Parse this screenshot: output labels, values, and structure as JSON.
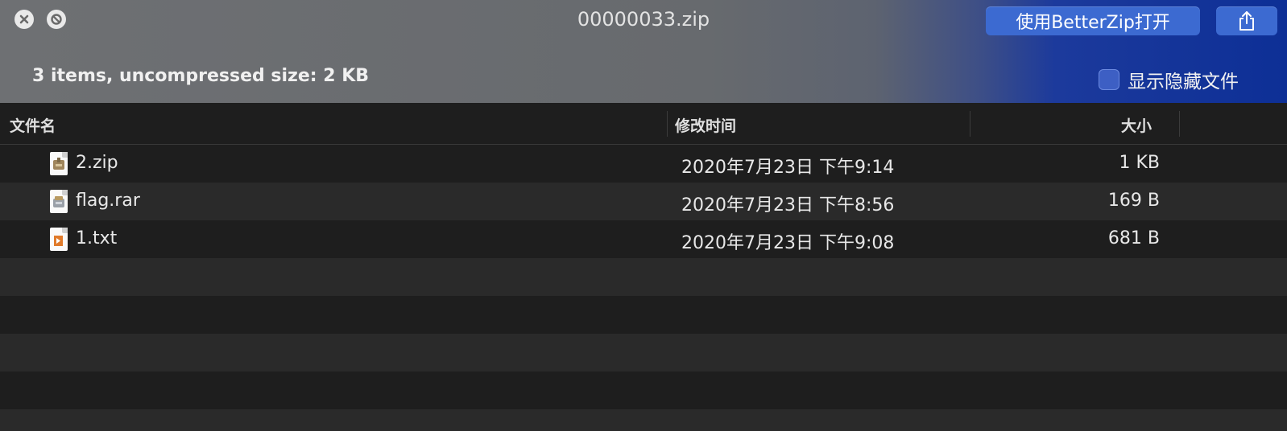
{
  "window": {
    "title": "00000033.zip",
    "close_icon": "close-circle-icon",
    "block_icon": "no-entry-icon"
  },
  "toolbar": {
    "open_label": "使用BetterZip打开",
    "share_icon": "share-icon",
    "accent": "#3c6ad1"
  },
  "summary": {
    "text": "3 items, uncompressed size: 2 KB"
  },
  "options": {
    "show_hidden_label": "显示隐藏文件",
    "show_hidden_checked": false
  },
  "table": {
    "columns": [
      "文件名",
      "修改时间",
      "大小"
    ],
    "rows": [
      {
        "name": "2.zip",
        "icon": "zip-archive-icon",
        "modified": "2020年7月23日 下午9:14",
        "size": "1 KB"
      },
      {
        "name": "flag.rar",
        "icon": "rar-archive-icon",
        "modified": "2020年7月23日 下午8:56",
        "size": "169 B"
      },
      {
        "name": "1.txt",
        "icon": "text-file-icon",
        "modified": "2020年7月23日 下午9:08",
        "size": "681 B"
      }
    ]
  }
}
